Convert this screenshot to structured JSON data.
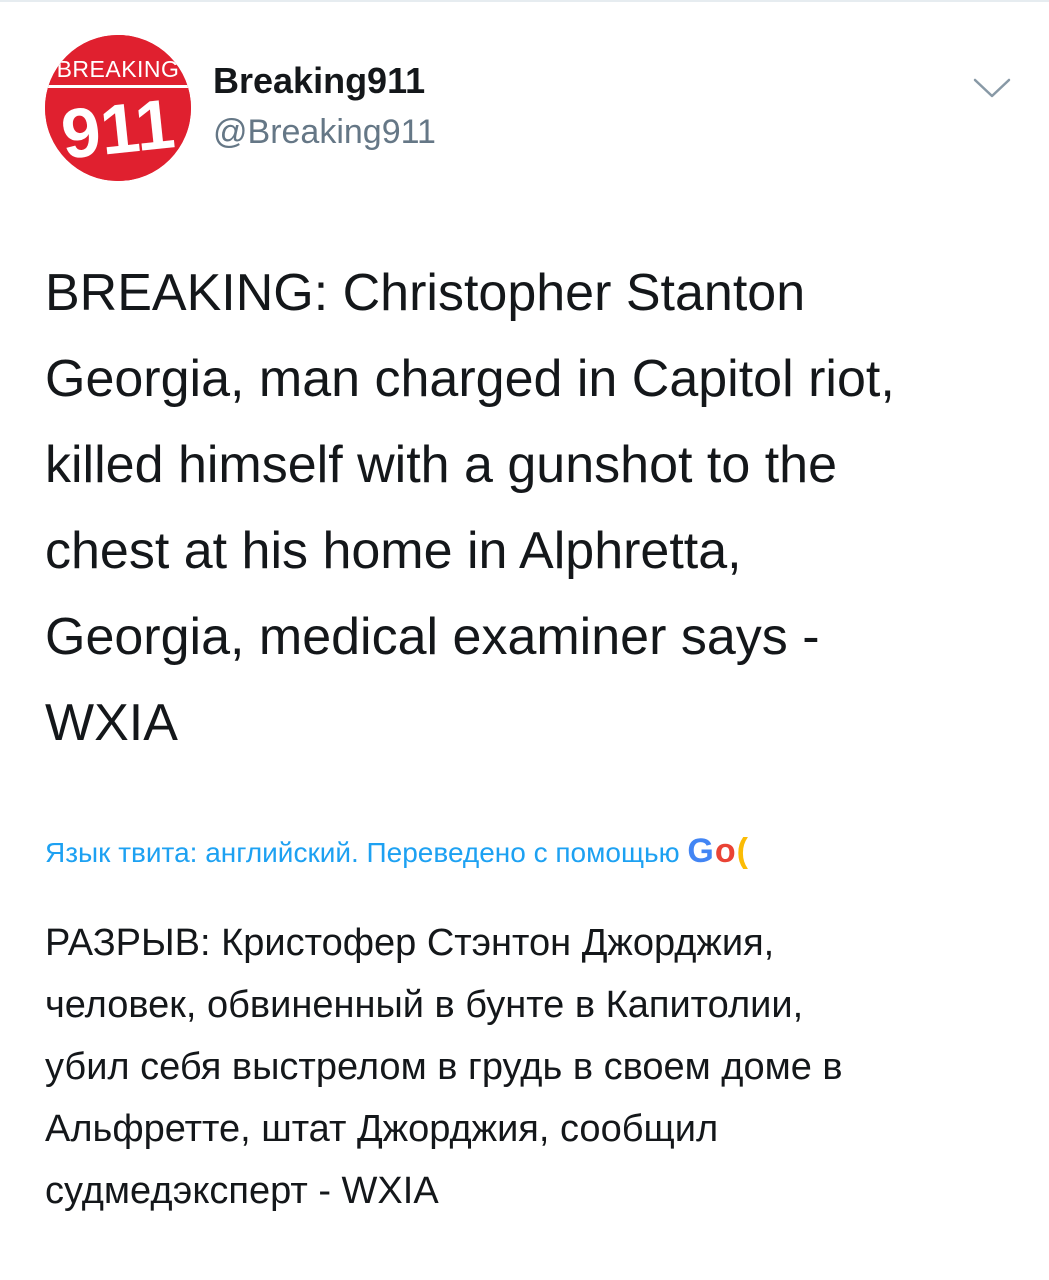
{
  "tweet": {
    "author": {
      "display_name": "Breaking911",
      "handle": "@Breaking911",
      "avatar": {
        "banner_text": "BREAKING",
        "number_text": "911",
        "background_color": "#e0202f"
      }
    },
    "menu_icon": "chevron-down-icon",
    "text": "BREAKING: Christopher Stanton\nGeorgia, man charged in Capitol riot,\nkilled himself with a gunshot to the\nchest at his home in Alphretta,\nGeorgia, medical examiner says -\nWXIA",
    "translation": {
      "note": "Язык твита: английский. Переведено с помощью ",
      "provider_visible_text": "Go",
      "text": "РАЗРЫВ: Кристофер Стэнтон Джорджия,\nчеловек, обвиненный в бунте в Капитолии,\nубил себя выстрелом в грудь в своем доме в\nАльфретте, штат Джорджия, сообщил\nсудмедэксперт - WXIA"
    }
  },
  "colors": {
    "link_blue": "#1da1f2",
    "secondary_text": "#657786",
    "primary_text": "#14171a"
  }
}
